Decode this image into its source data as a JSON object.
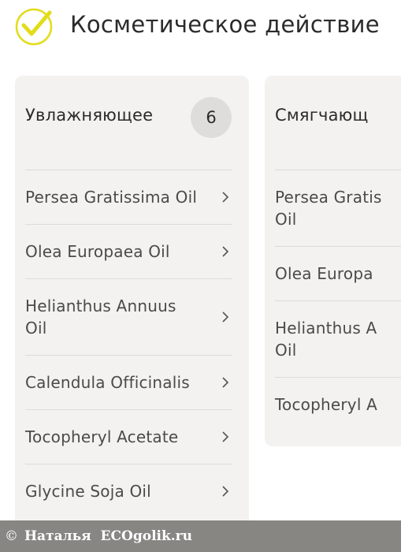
{
  "header": {
    "title": "Косметическое действие",
    "icon": "check-circle-icon",
    "accent": "#e3dc1b"
  },
  "cards": [
    {
      "title": "Увлажняющее",
      "count": "6",
      "items": [
        "Persea Gratissima Oil",
        "Olea Europaea Oil",
        "Helianthus Annuus Oil",
        "Calendula Officinalis",
        "Tocopheryl Acetate",
        "Glycine Soja Oil"
      ]
    },
    {
      "title": "Смягчающ",
      "items": [
        "Persea Gratis Oil",
        "Olea Europa",
        "Helianthus A Oil",
        "Tocopheryl A"
      ]
    }
  ],
  "footer": {
    "copyright": "©",
    "text": "Наталья  ECOgolik.ru"
  }
}
